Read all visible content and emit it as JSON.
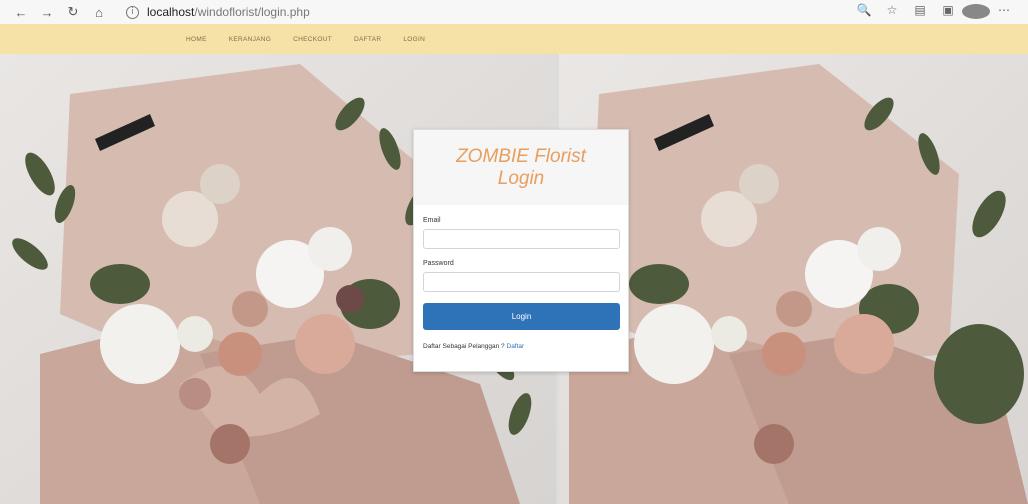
{
  "browser": {
    "back_icon": "back-arrow-icon",
    "url_host": "localhost",
    "url_path": "/windoflorist/login.php",
    "right_icons": [
      "zoom-icon",
      "bookmark-star-icon",
      "collections-icon",
      "extensions-icon",
      "profile-icon",
      "menu-icon"
    ]
  },
  "nav": {
    "items": [
      "HOME",
      "KERANJANG",
      "CHECKOUT",
      "DAFTAR",
      "LOGIN"
    ]
  },
  "login": {
    "title_line1": "ZOMBIE Florist",
    "title_line2": "Login",
    "email_label": "Email",
    "email_value": "",
    "password_label": "Password",
    "password_value": "",
    "button_label": "Login",
    "register_text": "Daftar Sebagai Pelanggan ?",
    "register_link": "Daftar"
  },
  "colors": {
    "nav_bg": "#f6e2a6",
    "title_accent": "#e89e5e",
    "button_blue": "#2e73b8"
  }
}
